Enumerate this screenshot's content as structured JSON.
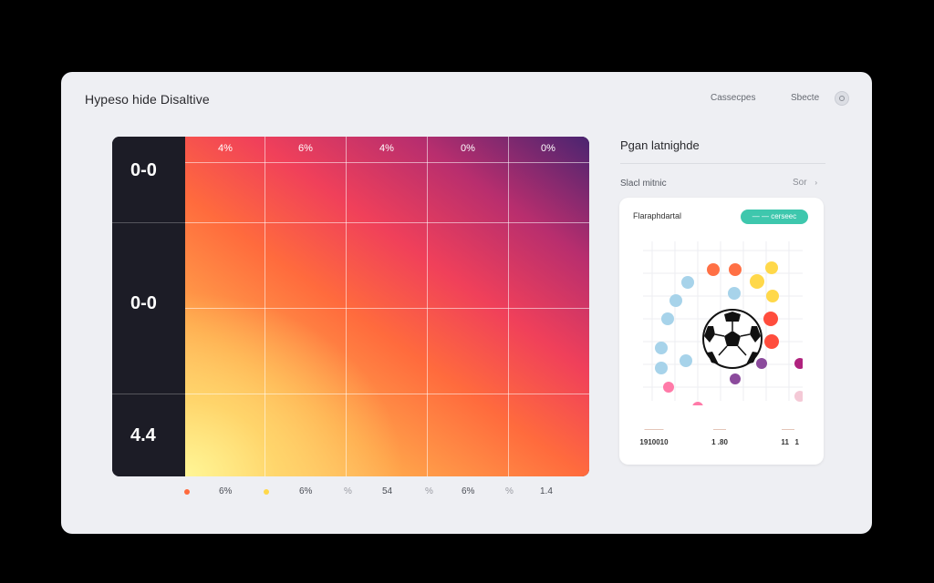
{
  "window": {
    "title": "Hypeso hide Disaltive",
    "top_links": [
      "Cassecpes",
      "Sbecte"
    ],
    "help_icon": "help-circle-icon"
  },
  "heatmap": {
    "column_labels": [
      "4%",
      "6%",
      "4%",
      "0%",
      "0%"
    ],
    "row_labels": [
      "0-0",
      "0-0",
      "4.4"
    ],
    "colors": {
      "low": "#fff58a",
      "mid": "#ff6b3d",
      "high": "#4a2470",
      "sidebar": "#1c1c26"
    }
  },
  "legend": [
    {
      "dot_color": "#ff6a3d",
      "label": "6%"
    },
    {
      "dot_color": "#ffd84a",
      "label": "6%"
    },
    {
      "dot_color": null,
      "label": "54"
    },
    {
      "dot_color": null,
      "label": "6%"
    },
    {
      "dot_color": null,
      "label": "1.4"
    }
  ],
  "legend_separators": [
    "%",
    "%",
    "%"
  ],
  "side_panel": {
    "title": "Pgan latnighde",
    "subtitle": "Slacl mitnic",
    "filter_label": "Sor",
    "card": {
      "title": "Flaraphdartal",
      "button_label": "— — cerseec",
      "ball_icon": "soccer-ball-icon",
      "stats": [
        {
          "label": "———",
          "value": "1910010"
        },
        {
          "label": "——",
          "value": "1 .80"
        },
        {
          "label": "——",
          "value": "  11   1"
        }
      ],
      "dot_colors": {
        "orange": "#ff7045",
        "yellow": "#ffd84a",
        "red": "#ff4d3d",
        "blue": "#a7d3ea",
        "purple": "#8b4a9c",
        "magenta": "#b0227e",
        "pink": "#ff7aa8",
        "light_pink": "#f4c9d6"
      }
    }
  }
}
